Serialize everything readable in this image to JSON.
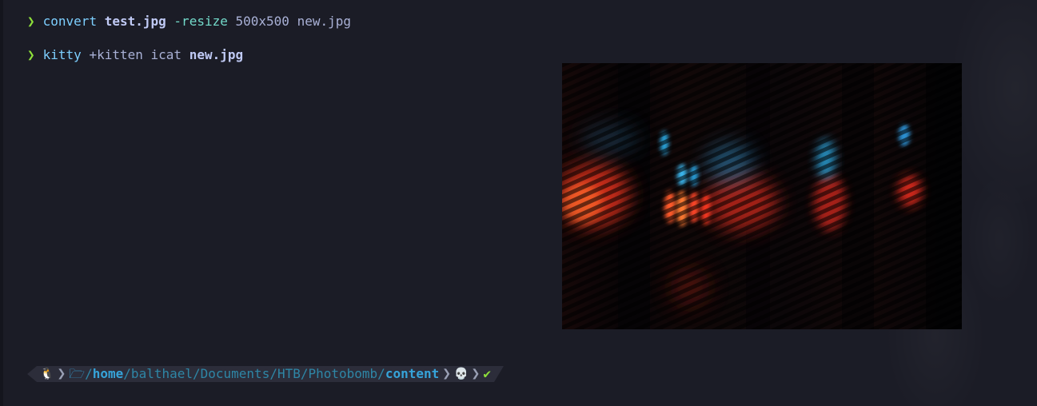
{
  "terminal": {
    "line1": {
      "prompt_symbol": "❯",
      "command": "convert",
      "source_file": "test.jpg",
      "flag": "-resize",
      "size": "500x500",
      "output_file": "new.jpg"
    },
    "line2": {
      "prompt_symbol": "❯",
      "command": "kitty",
      "subcommand": "+kitten icat",
      "file": "new.jpg"
    },
    "prompt": {
      "os_glyph": "🐧",
      "separator": "❯",
      "folder_glyph": "🗁",
      "path_parts": [
        "/",
        "home",
        "/balthael/Documents/HTB/Photobomb/",
        "content"
      ],
      "root_glyph": "💀",
      "status_glyph": "✔"
    }
  },
  "colors": {
    "background": "#1b1c26",
    "prompt_arrow": "#8ee03a",
    "command": "#7dcfff",
    "path": "#36a3d9",
    "root_icon": "#e0af68",
    "status_ok": "#8ee03a"
  },
  "image": {
    "description_icon": "image-output",
    "dominant_colors": [
      "#e0301f",
      "#2fa7d8",
      "#07070a"
    ]
  }
}
